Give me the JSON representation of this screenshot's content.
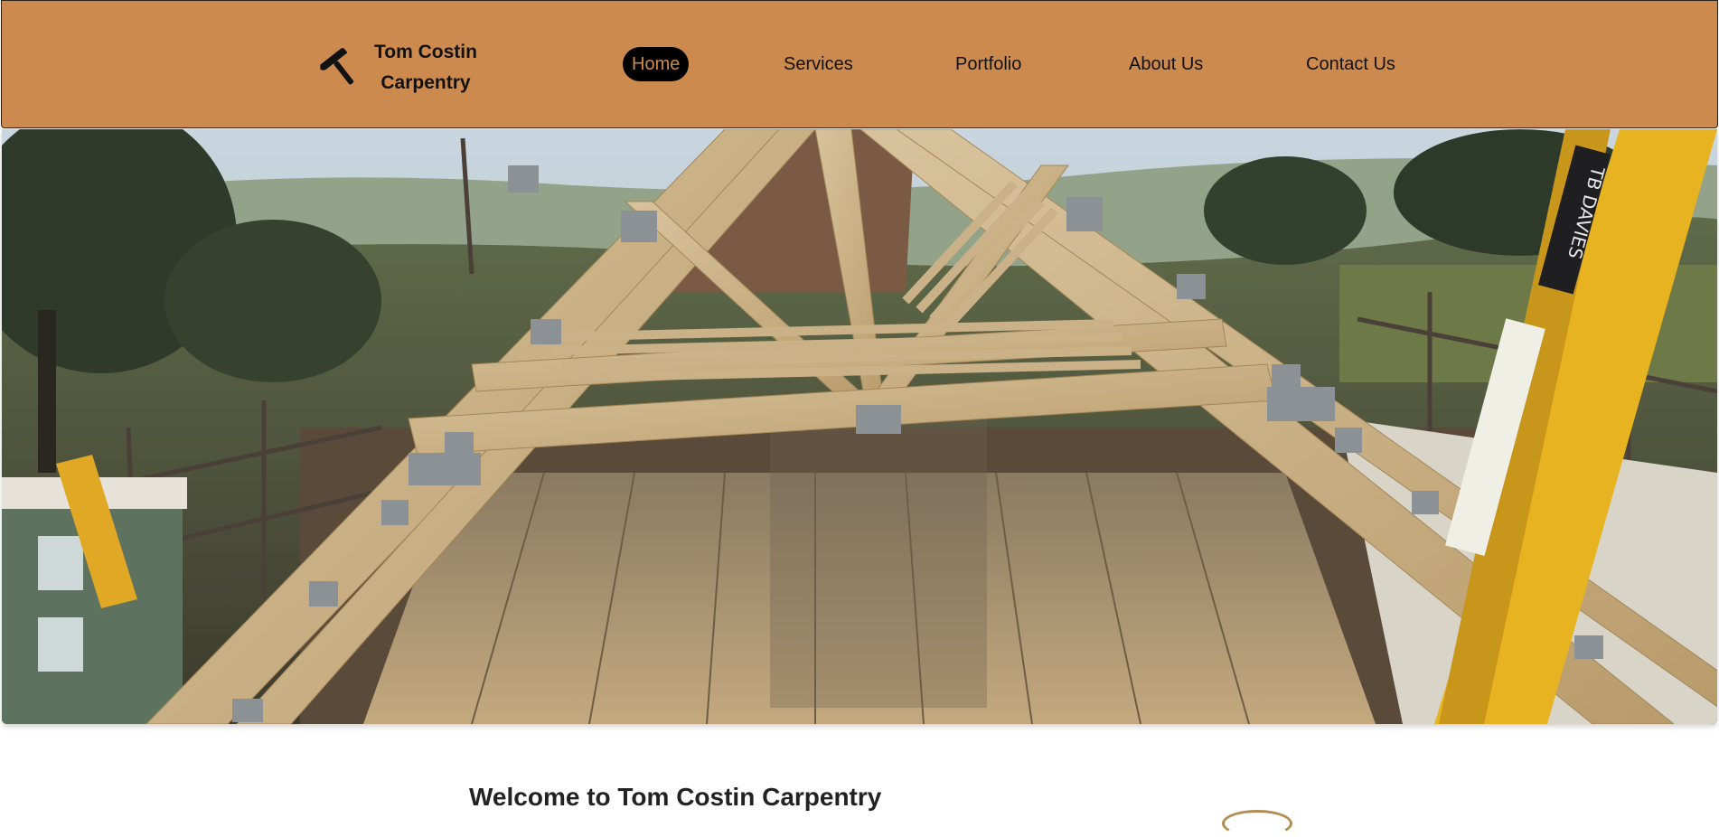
{
  "nav": {
    "brand": {
      "icon": "hammer-icon",
      "line1": "Tom Costin",
      "line2": "Carpentry"
    },
    "links": [
      "Home",
      "Services",
      "Portfolio",
      "About Us",
      "Contact Us"
    ],
    "active": "Home"
  },
  "hero": {
    "image": "roof-trusses-construction-photo",
    "ladder_text": "TB DAVIES"
  },
  "main": {
    "heading": "Welcome to Tom Costin Carpentry"
  },
  "colors": {
    "navbar": "#cd8a4e",
    "active_pill": "#000000",
    "active_text": "#cd8a4e",
    "text": "#111111"
  }
}
